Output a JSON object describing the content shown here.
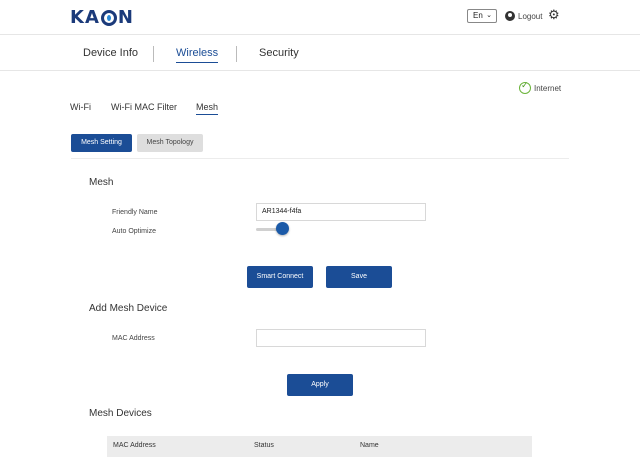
{
  "header": {
    "logo": "KAON",
    "language": "En",
    "logout_label": "Logout"
  },
  "topnav": {
    "tabs": [
      "Device Info",
      "Wireless",
      "Security"
    ],
    "active": "Wireless"
  },
  "status": {
    "internet_label": "Internet"
  },
  "subtabs": {
    "items": [
      "Wi-Fi",
      "Wi-Fi MAC Filter",
      "Mesh"
    ],
    "active": "Mesh"
  },
  "mesh_tabs": {
    "setting_label": "Mesh Setting",
    "topology_label": "Mesh Topology"
  },
  "mesh": {
    "title": "Mesh",
    "friendly_name_label": "Friendly Name",
    "friendly_name_value": "AR1344-f4fa",
    "auto_optimize_label": "Auto Optimize",
    "auto_optimize_on": true,
    "smart_connect_label": "Smart Connect",
    "save_label": "Save"
  },
  "add_mesh": {
    "title": "Add Mesh Device",
    "mac_label": "MAC Address",
    "mac_value": "",
    "apply_label": "Apply"
  },
  "mesh_devices": {
    "title": "Mesh Devices",
    "columns": [
      "MAC Address",
      "Status",
      "Name"
    ]
  },
  "colors": {
    "brand": "#1b4d96",
    "accent": "#1b5aa8",
    "internet_ok": "#6bb43a"
  }
}
